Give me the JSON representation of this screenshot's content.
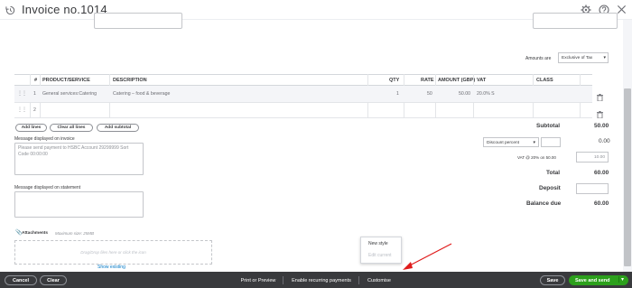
{
  "header": {
    "title": "Invoice no.1014"
  },
  "amounts": {
    "label": "Amounts are",
    "value": "Exclusive of Tax"
  },
  "table": {
    "columns": [
      "#",
      "PRODUCT/SERVICE",
      "DESCRIPTION",
      "QTY",
      "RATE",
      "AMOUNT (GBP)",
      "VAT",
      "CLASS"
    ],
    "rows": [
      {
        "num": "1",
        "product": "General services:Catering",
        "description": "Catering – food & beverage",
        "qty": "1",
        "rate": "50",
        "amount": "50.00",
        "vat": "20.0% S"
      },
      {
        "num": "2",
        "product": "",
        "description": "",
        "qty": "",
        "rate": "",
        "amount": "",
        "vat": ""
      }
    ]
  },
  "buttons": {
    "add_lines": "Add lines",
    "clear_all_lines": "Clear all lines",
    "add_subtotal": "Add subtotal"
  },
  "message_invoice": {
    "label": "Message displayed on invoice",
    "text": "Please send payment to HSBC Account 29299999 Sort Code 00:00:00"
  },
  "message_statement": {
    "label": "Message displayed on statement",
    "text": ""
  },
  "attachments": {
    "label": "Attachments",
    "max_size": "Maximum size: 25MB",
    "drop_text": "Drag/Drop files here or click the icon",
    "show_existing": "Show existing"
  },
  "summary": {
    "subtotal_label": "Subtotal",
    "subtotal_value": "50.00",
    "discount_select": "Discount percent",
    "discount_value": "0.00",
    "vat_label": "VAT @ 20% on 50.00",
    "vat_value": "10.00",
    "total_label": "Total",
    "total_value": "60.00",
    "deposit_label": "Deposit",
    "balance_label": "Balance due",
    "balance_value": "60.00"
  },
  "popup": {
    "new_style": "New style",
    "edit_current": "Edit current"
  },
  "footer": {
    "cancel": "Cancel",
    "clear": "Clear",
    "print_preview": "Print or Preview",
    "recurring": "Enable recurring payments",
    "customise": "Customise",
    "save": "Save",
    "save_send": "Save and send"
  },
  "colors": {
    "footer_bg": "#393a3d",
    "primary_green": "#2ca01c",
    "annotation_red": "#e01b1b"
  }
}
